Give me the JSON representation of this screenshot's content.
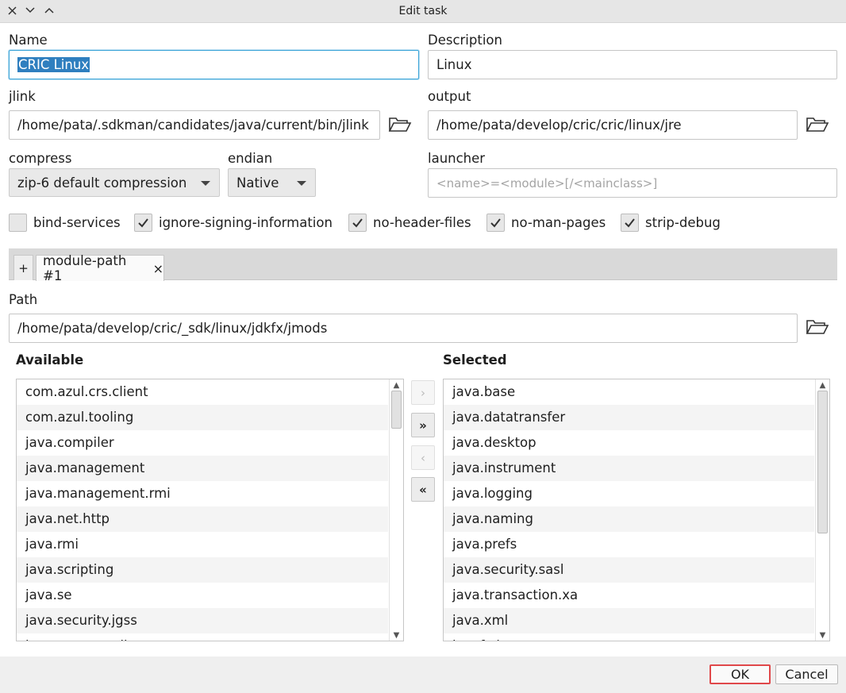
{
  "window": {
    "title": "Edit task"
  },
  "name": {
    "label": "Name",
    "value": "CRIC Linux"
  },
  "description": {
    "label": "Description",
    "value": "Linux"
  },
  "jlink": {
    "label": "jlink",
    "value": "/home/pata/.sdkman/candidates/java/current/bin/jlink"
  },
  "output": {
    "label": "output",
    "value": "/home/pata/develop/cric/cric/linux/jre"
  },
  "compress": {
    "label": "compress",
    "value": "zip-6 default compression"
  },
  "endian": {
    "label": "endian",
    "value": "Native"
  },
  "launcher": {
    "label": "launcher",
    "placeholder": "<name>=<module>[/<mainclass>]"
  },
  "options": [
    {
      "label": "bind-services",
      "checked": false
    },
    {
      "label": "ignore-signing-information",
      "checked": true
    },
    {
      "label": "no-header-files",
      "checked": true
    },
    {
      "label": "no-man-pages",
      "checked": true
    },
    {
      "label": "strip-debug",
      "checked": true
    }
  ],
  "tabs": {
    "add_label": "+",
    "items": [
      {
        "label": "module-path #1",
        "close": "×"
      }
    ]
  },
  "path": {
    "label": "Path",
    "value": "/home/pata/develop/cric/_sdk/linux/jdkfx/jmods"
  },
  "available": {
    "header": "Available",
    "items": [
      "com.azul.crs.client",
      "com.azul.tooling",
      "java.compiler",
      "java.management",
      "java.management.rmi",
      "java.net.http",
      "java.rmi",
      "java.scripting",
      "java.se",
      "java.security.jgss",
      "java.smartcardio"
    ],
    "scroll_fraction": 0
  },
  "selected": {
    "header": "Selected",
    "items": [
      "java.base",
      "java.datatransfer",
      "java.desktop",
      "java.instrument",
      "java.logging",
      "java.naming",
      "java.prefs",
      "java.security.sasl",
      "java.transaction.xa",
      "java.xml",
      "javafx.base"
    ],
    "scroll_fraction": 0
  },
  "move_buttons": [
    {
      "label": "›",
      "enabled": false
    },
    {
      "label": "»",
      "enabled": true
    },
    {
      "label": "‹",
      "enabled": false
    },
    {
      "label": "«",
      "enabled": true
    }
  ],
  "buttons": {
    "ok": "OK",
    "cancel": "Cancel"
  },
  "colors": {
    "focus": "#3aa4d8",
    "selection": "#2f7fbf",
    "default_button_border": "#e0484a"
  }
}
